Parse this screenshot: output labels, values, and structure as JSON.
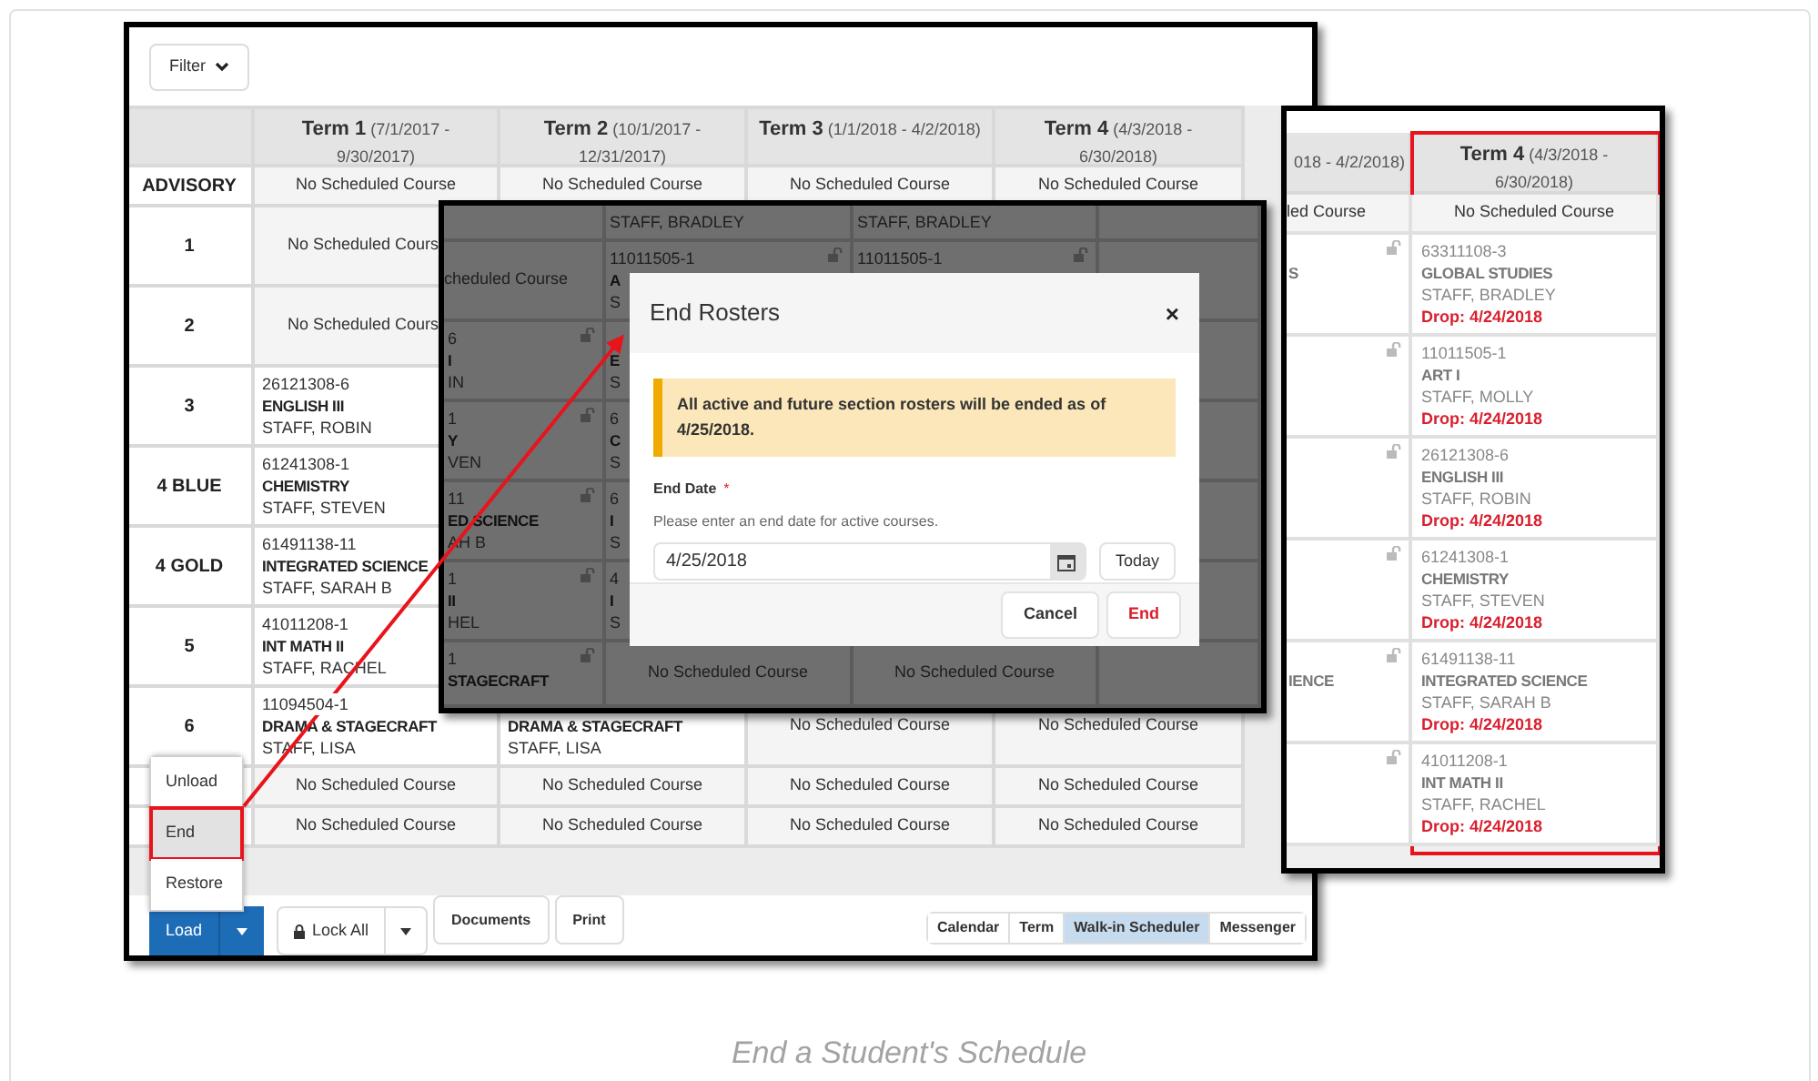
{
  "main_window": {
    "filter_button": "Filter",
    "columns": [
      {
        "term": "Term 1",
        "dates": "(7/1/2017 - 9/30/2017)"
      },
      {
        "term": "Term 2",
        "dates": "(10/1/2017 - 12/31/2017)"
      },
      {
        "term": "Term 3",
        "dates": "(1/1/2018 - 4/2/2018)"
      },
      {
        "term": "Term 4",
        "dates": "(4/3/2018 - 6/30/2018)"
      }
    ],
    "rows": [
      {
        "kind": "single",
        "label": "ADVISORY",
        "cells": [
          {
            "note": "No Scheduled Course"
          },
          {
            "note": "No Scheduled Course"
          },
          {
            "note": "No Scheduled Course"
          },
          {
            "note": "No Scheduled Course"
          }
        ]
      },
      {
        "kind": "course",
        "label": "1",
        "cells": [
          {
            "note": "No Scheduled Cours"
          },
          {},
          {},
          {}
        ]
      },
      {
        "kind": "course",
        "label": "2",
        "cells": [
          {
            "note": "No Scheduled Cours"
          },
          {},
          {},
          {}
        ]
      },
      {
        "kind": "course",
        "label": "3",
        "cells": [
          {
            "number": "26121308-6",
            "course": "ENGLISH III",
            "staff": "STAFF, ROBIN"
          },
          {},
          {},
          {}
        ]
      },
      {
        "kind": "course",
        "label": "4 BLUE",
        "cells": [
          {
            "number": "61241308-1",
            "course": "CHEMISTRY",
            "staff": "STAFF, STEVEN"
          },
          {},
          {},
          {}
        ]
      },
      {
        "kind": "course",
        "label": "4 GOLD",
        "cells": [
          {
            "number": "61491138-11",
            "course": "INTEGRATED SCIENCE",
            "staff": "STAFF, SARAH B"
          },
          {},
          {},
          {}
        ]
      },
      {
        "kind": "course",
        "label": "5",
        "cells": [
          {
            "number": "41011208-1",
            "course": "INT MATH II",
            "staff": "STAFF, RACHEL"
          },
          {},
          {},
          {}
        ]
      },
      {
        "kind": "course",
        "label": "6",
        "cells": [
          {
            "number": "11094504-1",
            "course": "DRAMA & STAGECRAFT",
            "staff": "STAFF, LISA"
          },
          {
            "course": "DRAMA & STAGECRAFT",
            "staff": "STAFF, LISA"
          },
          {
            "note": "No Scheduled Course"
          },
          {
            "note": "No Scheduled Course"
          }
        ]
      },
      {
        "kind": "single",
        "cells": [
          {
            "note": "No Scheduled Course"
          },
          {
            "note": "No Scheduled Course"
          },
          {
            "note": "No Scheduled Course"
          },
          {
            "note": "No Scheduled Course"
          }
        ]
      },
      {
        "kind": "single",
        "cells": [
          {
            "note": "No Scheduled Course"
          },
          {
            "note": "No Scheduled Course"
          },
          {
            "note": "No Scheduled Course"
          },
          {
            "note": "No Scheduled Course"
          }
        ]
      }
    ],
    "menu": [
      {
        "label": "Unload",
        "selected": false,
        "highlighted": false
      },
      {
        "label": "End",
        "selected": true,
        "highlighted": true
      },
      {
        "label": "Restore",
        "selected": false,
        "highlighted": false
      }
    ],
    "toolbar": {
      "load_button": "Load",
      "lock_button": "Lock All",
      "buttons": [
        "Documents",
        "Print"
      ]
    },
    "view_tabs": [
      {
        "label": "Calendar",
        "selected": false
      },
      {
        "label": "Term",
        "selected": false
      },
      {
        "label": "Walk-in Scheduler",
        "selected": true
      },
      {
        "label": "Messenger",
        "selected": false
      }
    ]
  },
  "overlay_window": {
    "rows": [
      [
        {},
        {
          "staff": "STAFF, BRADLEY"
        },
        {
          "staff": "STAFF, BRADLEY"
        },
        {}
      ],
      [
        {
          "note": "cheduled Course"
        },
        {
          "number": "11011505-1",
          "course": "A",
          "staff": "S",
          "lock_icon": true
        },
        {
          "number": "11011505-1",
          "lock_icon": true
        },
        {}
      ],
      [
        {
          "number": "6",
          "course": "I",
          "staff": "IN",
          "lock_icon": true
        },
        {
          "course": "E",
          "staff": "S"
        },
        {},
        {}
      ],
      [
        {
          "number": "1",
          "course": "Y",
          "staff": "VEN",
          "lock_icon": true
        },
        {
          "number": "6",
          "course": "C",
          "staff": "S"
        },
        {},
        {}
      ],
      [
        {
          "number": "11",
          "course": "ED SCIENCE",
          "staff": "AH B",
          "lock_icon": true
        },
        {
          "number": "6",
          "course": "I",
          "staff": "S"
        },
        {},
        {}
      ],
      [
        {
          "number": "1",
          "course": "II",
          "staff": "HEL",
          "lock_icon": true
        },
        {
          "number": "4",
          "course": "I",
          "staff": "S"
        },
        {},
        {}
      ],
      [
        {
          "number": "1",
          "course": "STAGECRAFT",
          "lock_icon": true
        },
        {
          "note": "No Scheduled Course"
        },
        {
          "note": "No Scheduled Course"
        },
        {}
      ]
    ],
    "dialog": {
      "title": "End Rosters",
      "close": "×",
      "notice": "All active and future section rosters will be ended as of 4/25/2018.",
      "field_label": "End Date",
      "required_mark": "*",
      "hint": "Please enter an end date for active courses.",
      "value": "4/25/2018",
      "today_button": "Today",
      "buttons": [
        "Cancel",
        "End"
      ]
    }
  },
  "right_window": {
    "columns": [
      {
        "header": "018 - 4/2/2018)",
        "cells": [
          {
            "note": "led Course"
          },
          {
            "course": "S",
            "lock_icon": true
          },
          {
            "lock_icon": true
          },
          {
            "lock_icon": true
          },
          {
            "lock_icon": true
          },
          {
            "course": "IENCE",
            "lock_icon": true
          },
          {
            "lock_icon": true
          }
        ]
      },
      {
        "term": "Term 4",
        "dates": "(4/3/2018 - 6/30/2018)",
        "highlighted": true,
        "cells": [
          {
            "note": "No Scheduled Course"
          },
          {
            "number": "63311108-3",
            "course": "GLOBAL STUDIES",
            "staff": "STAFF, BRADLEY",
            "drop": "Drop: 4/24/2018"
          },
          {
            "number": "11011505-1",
            "course": "ART I",
            "staff": "STAFF, MOLLY",
            "drop": "Drop: 4/24/2018"
          },
          {
            "number": "26121308-6",
            "course": "ENGLISH III",
            "staff": "STAFF, ROBIN",
            "drop": "Drop: 4/24/2018"
          },
          {
            "number": "61241308-1",
            "course": "CHEMISTRY",
            "staff": "STAFF, STEVEN",
            "drop": "Drop: 4/24/2018"
          },
          {
            "number": "61491138-11",
            "course": "INTEGRATED SCIENCE",
            "staff": "STAFF, SARAH B",
            "drop": "Drop: 4/24/2018"
          },
          {
            "number": "41011208-1",
            "course": "INT MATH II",
            "staff": "STAFF, RACHEL",
            "drop": "Drop: 4/24/2018"
          }
        ]
      }
    ]
  },
  "caption": "End a Student's Schedule"
}
